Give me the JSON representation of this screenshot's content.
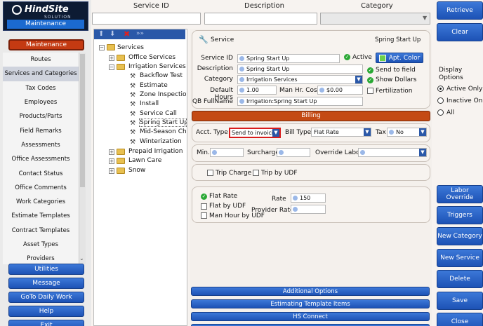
{
  "app": {
    "logo_text": "HindSite",
    "logo_sub": "SOLUTION",
    "module": "Maintenance"
  },
  "left": {
    "active_button": "Maintenance",
    "items": [
      "Routes",
      "Services and Categories",
      "Tax Codes",
      "Employees",
      "Products/Parts",
      "Field Remarks",
      "Assessments",
      "Office Assessments",
      "Contact Status",
      "Office Comments",
      "Work Categories",
      "Estimate Templates",
      "Contract Templates",
      "Asset Types",
      "Providers"
    ],
    "bottom_buttons": [
      "Utilities",
      "Message",
      "GoTo Daily Work",
      "Help",
      "Exit"
    ]
  },
  "header": {
    "service_id": "Service ID",
    "description": "Description",
    "category": "Category"
  },
  "tree": {
    "root": "Services",
    "nodes": [
      "Office Services",
      "Irrigation Services",
      "Backflow Test",
      "Estimate",
      "Zone Inspection",
      "Install",
      "Service Call",
      "Spring Start Up",
      "Mid-Season Che",
      "Winterization",
      "Prepaid Irrigation",
      "Lawn Care",
      "Snow"
    ]
  },
  "detail": {
    "title": "Service",
    "title_right": "Spring Start Up",
    "service_id_label": "Service ID",
    "service_id": "Spring Start Up",
    "active_label": "Active",
    "apt_color": "Apt. Color",
    "description_label": "Description",
    "description": "Spring Start Up",
    "send_to_field": "Send to field",
    "category_label": "Category",
    "category": "Irrigation Services",
    "show_dollars": "Show Dollars",
    "default_hours_label": "Default Hours",
    "default_hours": "1.00",
    "man_hr_cost_label": "Man Hr. Cost",
    "man_hr_cost": "$0.00",
    "fertilization": "Fertilization",
    "qb_fullname_label": "QB FullName",
    "qb_fullname": "Irrigation:Spring Start Up"
  },
  "billing": {
    "header": "Billing",
    "acct_type_label": "Acct. Type",
    "acct_type": "Send to invoicing",
    "bill_type_label": "Bill Type",
    "bill_type": "Flat Rate",
    "tax_label": "Tax",
    "tax": "No",
    "min_label": "Min.",
    "surcharge_label": "Surcharge",
    "override_labor_label": "Override Labor",
    "trip_charge": "Trip Charge",
    "trip_by_udf": "Trip by UDF",
    "flat_rate": "Flat Rate",
    "flat_by_udf": "Flat by UDF",
    "man_hour_by_udf": "Man Hour by UDF",
    "rate_label": "Rate",
    "rate": "150",
    "provider_rate_label": "Provider Rate"
  },
  "bottom_sections": [
    "Additional Options",
    "Estimating Template Items",
    "HS Connect"
  ],
  "right": {
    "retrieve": "Retrieve",
    "clear": "Clear",
    "display_options_label": "Display Options",
    "options": [
      "Active Only",
      "Inactive Only",
      "All"
    ],
    "buttons": [
      "Labor Override",
      "Triggers",
      "New Category",
      "New Service",
      "Delete",
      "Save",
      "Close"
    ]
  },
  "colors": {
    "accent": "#1d52b5",
    "billing_bar": "#c44a14",
    "highlight": "#d81c1c"
  }
}
